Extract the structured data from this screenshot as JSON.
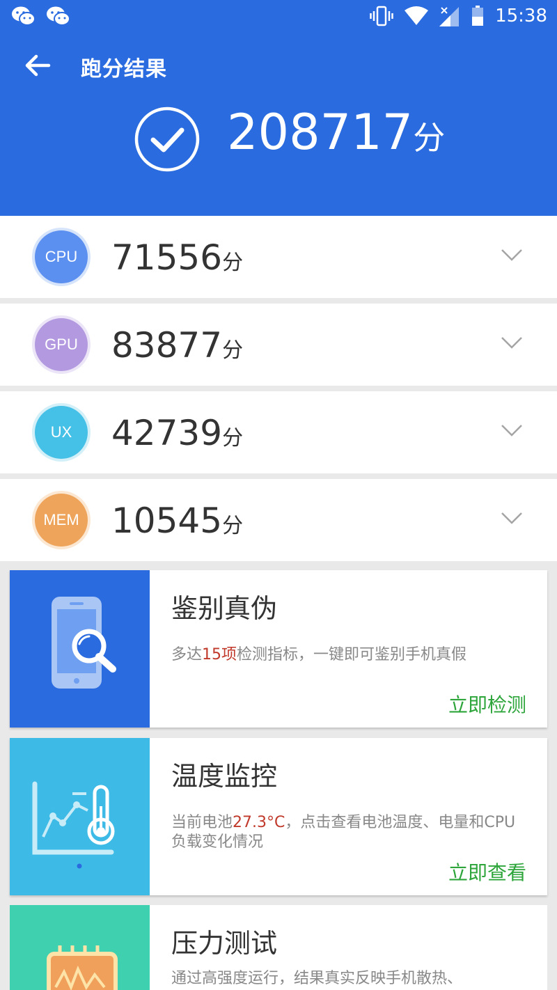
{
  "status_bar": {
    "time": "15:38",
    "icons": [
      "wechat-icon",
      "wechat-icon",
      "vibrate-icon",
      "wifi-icon",
      "signal-icon",
      "battery-icon"
    ]
  },
  "toolbar": {
    "title": "跑分结果"
  },
  "total": {
    "score": "208717",
    "unit": "分"
  },
  "scores": [
    {
      "label": "CPU",
      "value": "71556",
      "unit": "分",
      "color": "#5b8ff0",
      "ring": "#d6e4fb"
    },
    {
      "label": "GPU",
      "value": "83877",
      "unit": "分",
      "color": "#b39ae0",
      "ring": "#ece5f8"
    },
    {
      "label": "UX",
      "value": "42739",
      "unit": "分",
      "color": "#45c0e6",
      "ring": "#d3eff8"
    },
    {
      "label": "MEM",
      "value": "10545",
      "unit": "分",
      "color": "#eea45a",
      "ring": "#fbe7d2"
    }
  ],
  "cards": [
    {
      "title": "鉴别真伪",
      "desc_pre": "多达",
      "desc_highlight": "15项",
      "desc_post": "检测指标，一键即可鉴别手机真假",
      "action": "立即检测",
      "color": "#2a6bdf"
    },
    {
      "title": "温度监控",
      "desc_pre": "当前电池",
      "desc_highlight": "27.3°C",
      "desc_post": "，点击查看电池温度、电量和CPU负载变化情况",
      "action": "立即查看",
      "color": "#3dbbe6"
    },
    {
      "title": "压力测试",
      "desc_pre": "通过高强度运行，结果真实反映手机散热、",
      "desc_highlight": "",
      "desc_post": "",
      "action": "",
      "color": "#3fd0b0"
    }
  ],
  "colors": {
    "header": "#2a6bdf",
    "action_green": "#2da53a",
    "highlight_red": "#c0392b"
  }
}
